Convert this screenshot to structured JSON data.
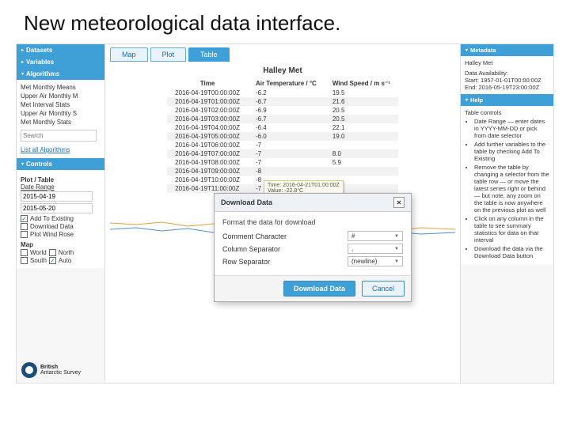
{
  "slide": {
    "title": "New meteorological data interface."
  },
  "sidebar": {
    "panels": {
      "datasets": "Datasets",
      "variables": "Variables",
      "algorithms": "Algorithms",
      "controls": "Controls"
    },
    "algorithms": {
      "items": [
        "Met Monthly Means",
        "Upper Air Monthly M",
        "Met Interval Stats",
        "Upper Air Monthly S",
        "Met Monthly Stats"
      ],
      "search_placeholder": "Search",
      "list_all": "List all Algorithms"
    },
    "controls": {
      "section": "Plot / Table",
      "date_range_label": "Date Range",
      "date_from": "2015-04-19",
      "date_to": "2015-05-20",
      "add_to_existing": "Add To Existing",
      "download_data": "Download Data",
      "plot_wind_rose": "Plot Wind Rose",
      "map_label": "Map",
      "world": "World",
      "north": "North",
      "south": "South",
      "auto": "Auto"
    },
    "logo": {
      "line1": "British",
      "line2": "Antarctic Survey"
    }
  },
  "main": {
    "tabs": [
      "Map",
      "Plot",
      "Table"
    ],
    "active_tab": 2,
    "table_title": "Halley Met",
    "columns": [
      "Time",
      "Air Temperature / °C",
      "Wind Speed / m s⁻¹"
    ],
    "rows": [
      [
        "2016-04-19T00:00:00Z",
        "-6.2",
        "19.5"
      ],
      [
        "2016-04-19T01:00:00Z",
        "-6.7",
        "21.6"
      ],
      [
        "2016-04-19T02:00:00Z",
        "-6.9",
        "20.5"
      ],
      [
        "2016-04-19T03:00:00Z",
        "-6.7",
        "20.5"
      ],
      [
        "2016-04-19T04:00:00Z",
        "-6.4",
        "22.1"
      ],
      [
        "2016-04-19T05:00:00Z",
        "-6.0",
        "19.0"
      ],
      [
        "2016-04-19T06:00:00Z",
        "-7",
        ""
      ],
      [
        "2016-04-19T07:00:00Z",
        "-7",
        "8.0"
      ],
      [
        "2016-04-19T08:00:00Z",
        "-7",
        "5.9"
      ],
      [
        "2016-04-19T09:00:00Z",
        "-8",
        ""
      ],
      [
        "2016-04-19T10:00:00Z",
        "-8",
        ""
      ],
      [
        "2016-04-19T11:00:00Z",
        "-7",
        ""
      ]
    ],
    "tooltip": {
      "line1": "Time: 2016-04-21T01:00:00Z",
      "line2": "Value: -22.8°C"
    }
  },
  "right": {
    "metadata_hdr": "Metadata",
    "station": "Halley Met",
    "availability_label": "Data Availability:",
    "start": "Start: 1957-01-01T00:00:00Z",
    "end": "End: 2016-05-19T23:00:00Z",
    "help_hdr": "Help",
    "help_title": "Table controls",
    "help_items": [
      "Date Range — enter dates in YYYY-MM-DD or pick from date selector",
      "Add further variables to the table by checking Add To Existing",
      "Remove the table by changing a selector from the table row — or move the latest series right or behind — but note, any zoom on the table is now anywhere on the previous plot as well",
      "Click on any column in the table to see summary statistics for data on that interval",
      "Download the data via the Download Data button"
    ]
  },
  "modal": {
    "title": "Download Data",
    "desc": "Format the data for download",
    "rows": [
      {
        "label": "Comment Character",
        "value": "#"
      },
      {
        "label": "Column Separator",
        "value": ","
      },
      {
        "label": "Row Separator",
        "value": "(newline)"
      }
    ],
    "primary": "Download Data",
    "cancel": "Cancel"
  }
}
